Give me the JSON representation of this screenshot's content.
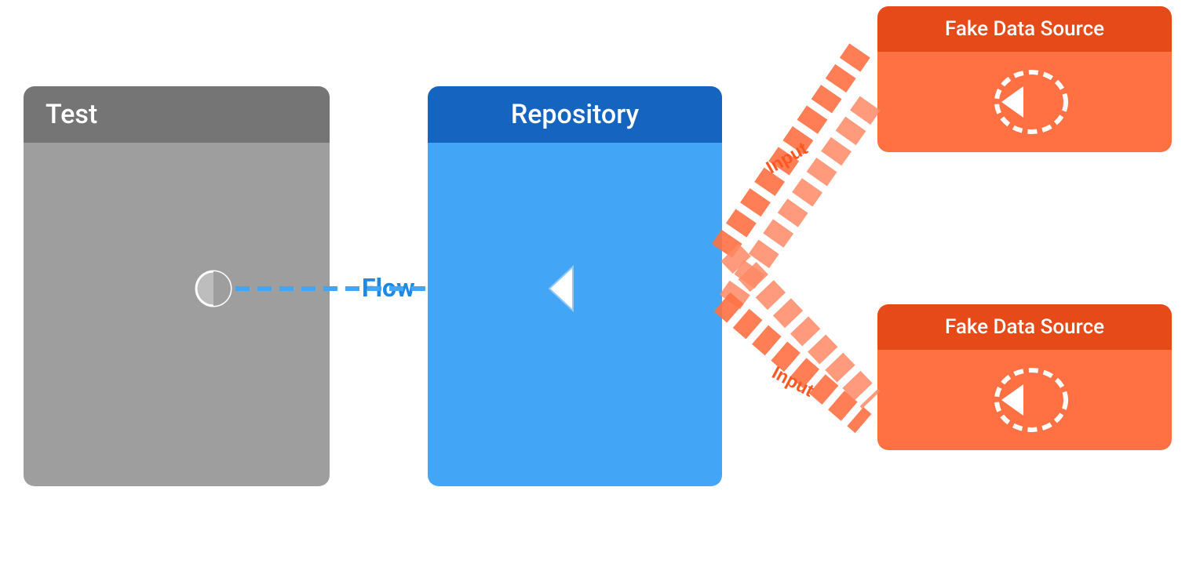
{
  "nodes": {
    "test": {
      "title": "Test"
    },
    "repository": {
      "title": "Repository"
    },
    "fakeDataSource1": {
      "title": "Fake Data Source",
      "inputLabel": "Input"
    },
    "fakeDataSource2": {
      "title": "Fake Data Source",
      "inputLabel": "Input"
    }
  },
  "connections": {
    "flowLabel": "Flow"
  }
}
